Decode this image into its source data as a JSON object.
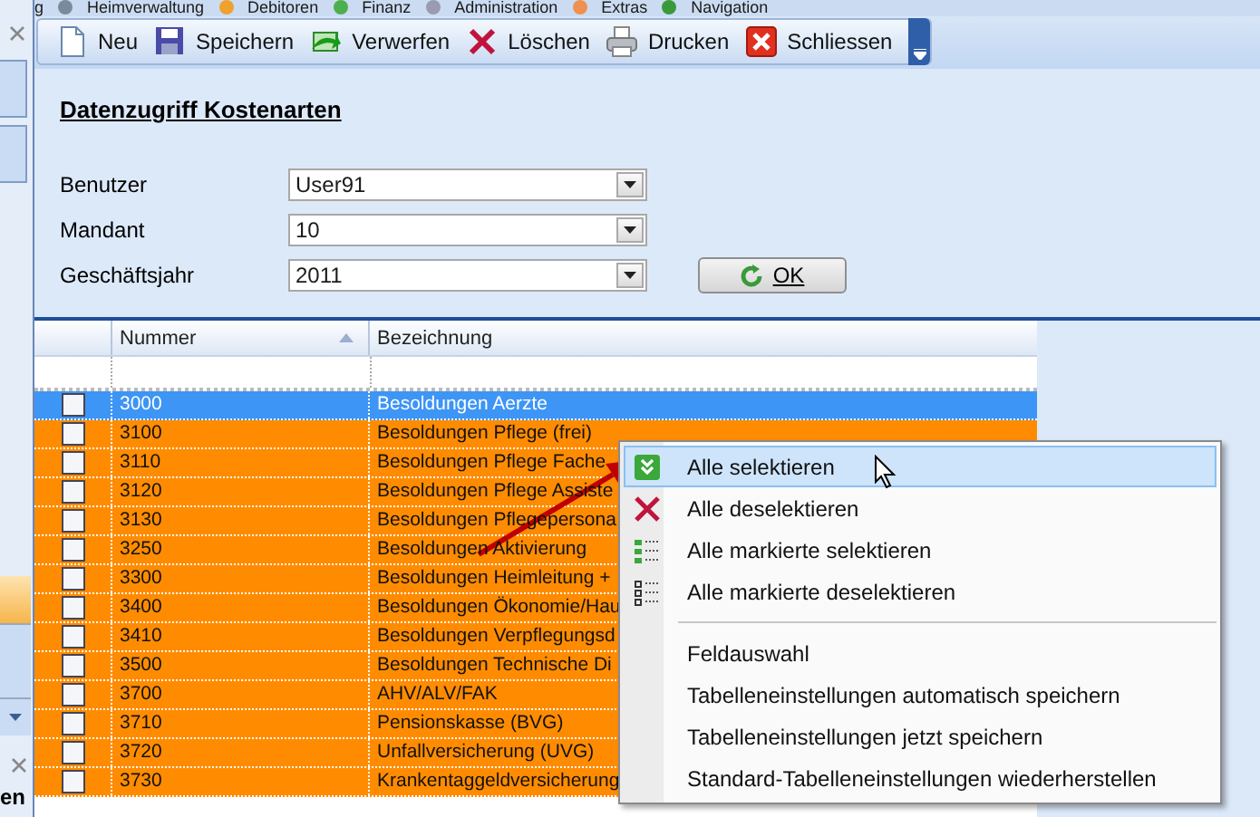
{
  "menu_bar": [
    {
      "label": "g"
    },
    {
      "label": "Heimverwaltung"
    },
    {
      "label": "Debitoren"
    },
    {
      "label": "Finanz"
    },
    {
      "label": "Administration"
    },
    {
      "label": "Extras"
    },
    {
      "label": "Navigation"
    }
  ],
  "side_panel": {
    "text": "en"
  },
  "toolbar": [
    {
      "kind": "new",
      "label": "Neu"
    },
    {
      "kind": "save",
      "label": "Speichern"
    },
    {
      "kind": "discard",
      "label": "Verwerfen"
    },
    {
      "kind": "delete",
      "label": "Löschen"
    },
    {
      "kind": "print",
      "label": "Drucken"
    },
    {
      "kind": "close",
      "label": "Schliessen"
    }
  ],
  "title": "Datenzugriff Kostenarten",
  "form": [
    {
      "label": "Benutzer",
      "value": "User91"
    },
    {
      "label": "Mandant",
      "value": "10"
    },
    {
      "label": "Geschäftsjahr",
      "value": "2011"
    }
  ],
  "ok_button": {
    "label": "OK"
  },
  "table": {
    "columns": [
      {
        "label": "Nummer",
        "sorted": true
      },
      {
        "label": "Bezeichnung",
        "sorted": false
      }
    ],
    "rows": [
      {
        "number": "3000",
        "name": "Besoldungen Aerzte",
        "checked": false,
        "selected": true
      },
      {
        "number": "3100",
        "name": "Besoldungen Pflege (frei)",
        "checked": false,
        "selected": false
      },
      {
        "number": "3110",
        "name": "Besoldungen Pflege Fache",
        "checked": false,
        "selected": false
      },
      {
        "number": "3120",
        "name": "Besoldungen Pflege Assiste",
        "checked": false,
        "selected": false
      },
      {
        "number": "3130",
        "name": "Besoldungen Pflegepersona",
        "checked": false,
        "selected": false
      },
      {
        "number": "3250",
        "name": "Besoldungen Aktivierung",
        "checked": false,
        "selected": false
      },
      {
        "number": "3300",
        "name": "Besoldungen Heimleitung +",
        "checked": false,
        "selected": false
      },
      {
        "number": "3400",
        "name": "Besoldungen Ökonomie/Hau",
        "checked": false,
        "selected": false
      },
      {
        "number": "3410",
        "name": "Besoldungen Verpflegungsd",
        "checked": false,
        "selected": false
      },
      {
        "number": "3500",
        "name": "Besoldungen Technische Di",
        "checked": false,
        "selected": false
      },
      {
        "number": "3700",
        "name": "AHV/ALV/FAK",
        "checked": false,
        "selected": false
      },
      {
        "number": "3710",
        "name": "Pensionskasse (BVG)",
        "checked": false,
        "selected": false
      },
      {
        "number": "3720",
        "name": "Unfallversicherung (UVG)",
        "checked": false,
        "selected": false
      },
      {
        "number": "3730",
        "name": "Krankentaggeldversicherung",
        "checked": false,
        "selected": false
      }
    ]
  },
  "context_menu": {
    "groups": [
      [
        {
          "kind": "selectall",
          "label": "Alle selektieren",
          "selected": true
        },
        {
          "kind": "deselectall",
          "label": "Alle deselektieren",
          "selected": false
        },
        {
          "kind": "markselect",
          "label": "Alle markierte selektieren",
          "selected": false
        },
        {
          "kind": "markdeselect",
          "label": "Alle markierte deselektieren",
          "selected": false
        }
      ],
      [
        {
          "kind": "plain",
          "label": "Feldauswahl",
          "selected": false
        },
        {
          "kind": "plain",
          "label": "Tabelleneinstellungen automatisch speichern",
          "selected": false
        },
        {
          "kind": "plain",
          "label": "Tabelleneinstellungen jetzt speichern",
          "selected": false
        },
        {
          "kind": "plain",
          "label": "Standard-Tabelleneinstellungen wiederherstellen",
          "selected": false
        }
      ]
    ]
  }
}
